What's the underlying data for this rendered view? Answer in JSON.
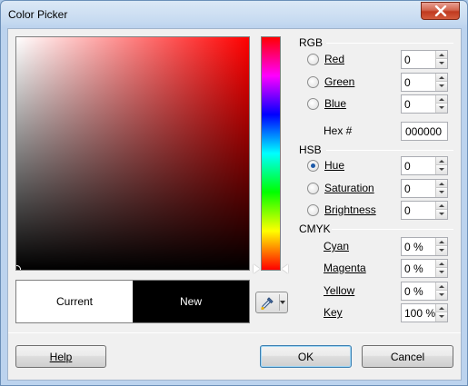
{
  "window": {
    "title": "Color Picker"
  },
  "preview": {
    "current_label": "Current",
    "new_label": "New"
  },
  "rgb": {
    "group_label": "RGB",
    "red": {
      "label": "Red",
      "value": "0"
    },
    "green": {
      "label": "Green",
      "value": "0"
    },
    "blue": {
      "label": "Blue",
      "value": "0"
    },
    "hex_label": "Hex #",
    "hex_value": "000000"
  },
  "hsb": {
    "group_label": "HSB",
    "hue": {
      "label": "Hue",
      "value": "0",
      "checked": true
    },
    "saturation": {
      "label": "Saturation",
      "value": "0"
    },
    "brightness": {
      "label": "Brightness",
      "value": "0"
    }
  },
  "cmyk": {
    "group_label": "CMYK",
    "cyan": {
      "label": "Cyan",
      "value": "0 %"
    },
    "magenta": {
      "label": "Magenta",
      "value": "0 %"
    },
    "yellow": {
      "label": "Yellow",
      "value": "0 %"
    },
    "key": {
      "label": "Key",
      "value": "100 %"
    }
  },
  "buttons": {
    "help": "Help",
    "ok": "OK",
    "cancel": "Cancel"
  },
  "colors": {
    "current": "#ffffff",
    "new": "#000000",
    "base_hue": "#ff0000"
  }
}
